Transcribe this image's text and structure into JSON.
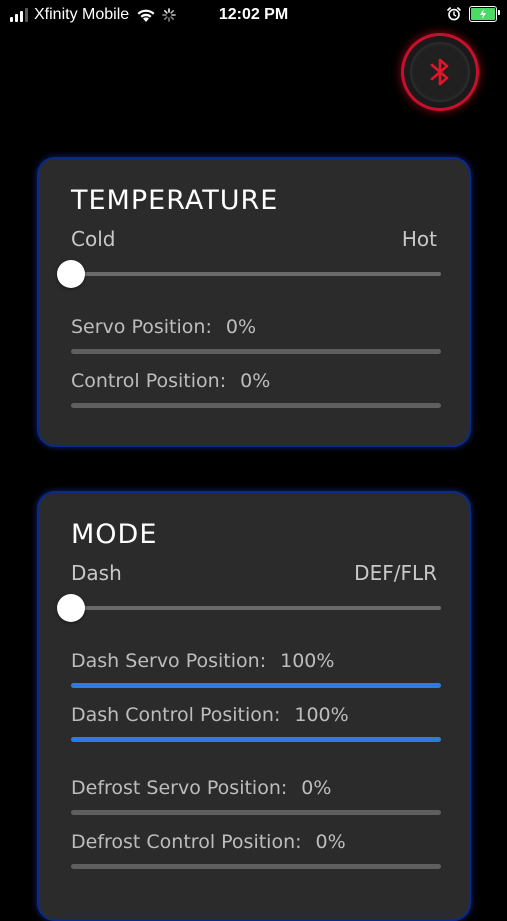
{
  "status_bar": {
    "carrier": "Xfinity Mobile",
    "time": "12:02 PM",
    "signal_icon": "signal-bars-icon",
    "wifi_icon": "wifi-icon",
    "activity_icon": "loading-spinner-icon",
    "alarm_icon": "alarm-clock-icon",
    "battery_icon": "battery-charging-icon"
  },
  "bluetooth_button": {
    "icon": "bluetooth-icon",
    "accent": "#e0162b"
  },
  "temperature": {
    "title": "TEMPERATURE",
    "min_label": "Cold",
    "max_label": "Hot",
    "slider_value": 0,
    "servo": {
      "label": "Servo Position:",
      "value": "0%",
      "fraction": 0
    },
    "control": {
      "label": "Control Position:",
      "value": "0%",
      "fraction": 0
    }
  },
  "mode": {
    "title": "MODE",
    "min_label": "Dash",
    "max_label": "DEF/FLR",
    "slider_value": 0,
    "dash_servo": {
      "label": "Dash Servo Position:",
      "value": "100%",
      "fraction": 1
    },
    "dash_control": {
      "label": "Dash Control Position:",
      "value": "100%",
      "fraction": 1
    },
    "defrost_servo": {
      "label": "Defrost Servo Position:",
      "value": "0%",
      "fraction": 0
    },
    "defrost_control": {
      "label": "Defrost Control Position:",
      "value": "0%",
      "fraction": 0
    }
  },
  "colors": {
    "background": "#000000",
    "card": "#2b2b2b",
    "card_border": "#0a2a8a",
    "progress_fill": "#2f7be6",
    "track": "#5f5f5f",
    "bluetooth_red": "#e0162b"
  }
}
